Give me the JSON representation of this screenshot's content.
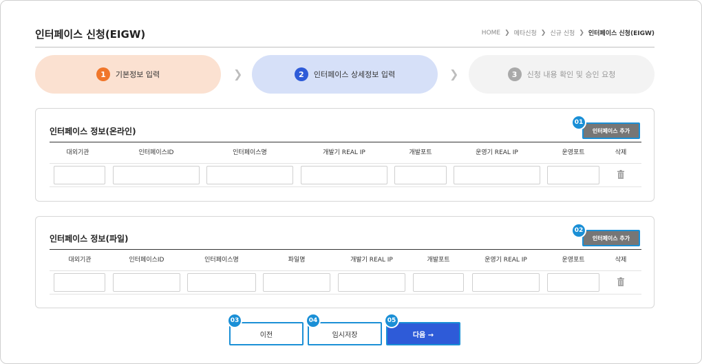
{
  "page": {
    "title": "인터페이스 신청(EIGW)",
    "breadcrumb": [
      "HOME",
      "메타신청",
      "신규 신청",
      "인터페이스 신청(EIGW)"
    ]
  },
  "steps": [
    {
      "num": "1",
      "label": "기본정보 입력"
    },
    {
      "num": "2",
      "label": "인터페이스 상세정보 입력"
    },
    {
      "num": "3",
      "label": "신청 내용 확인 및 승인 요청"
    }
  ],
  "online": {
    "title": "인터페이스 정보(온라인)",
    "add_label": "인터페이스 추가",
    "badge": "01",
    "columns": [
      "대외기관",
      "인터페이스ID",
      "인터페이스명",
      "개발기 REAL IP",
      "개발포트",
      "운영기 REAL IP",
      "운영포트",
      "삭제"
    ]
  },
  "file": {
    "title": "인터페이스 정보(파일)",
    "add_label": "인터페이스 추가",
    "badge": "02",
    "columns": [
      "대외기관",
      "인터페이스ID",
      "인터페이스명",
      "파일명",
      "개발기 REAL IP",
      "개발포트",
      "운영기 REAL IP",
      "운영포트",
      "삭제"
    ]
  },
  "actions": {
    "prev": {
      "badge": "03",
      "label": "이전"
    },
    "save": {
      "badge": "04",
      "label": "임시저장"
    },
    "next": {
      "badge": "05",
      "label": "다음 →"
    }
  },
  "colors": {
    "step1": "#f0762a",
    "step2": "#2e5bd8",
    "step3": "#a9a9a9",
    "badge": "#1a8fd6",
    "add_button": "#767676",
    "next_button": "#2e5bd8"
  },
  "icons": {
    "breadcrumb_separator": "chevron-right-icon",
    "step_separator": "chevron-right-icon",
    "delete": "trash-icon"
  }
}
